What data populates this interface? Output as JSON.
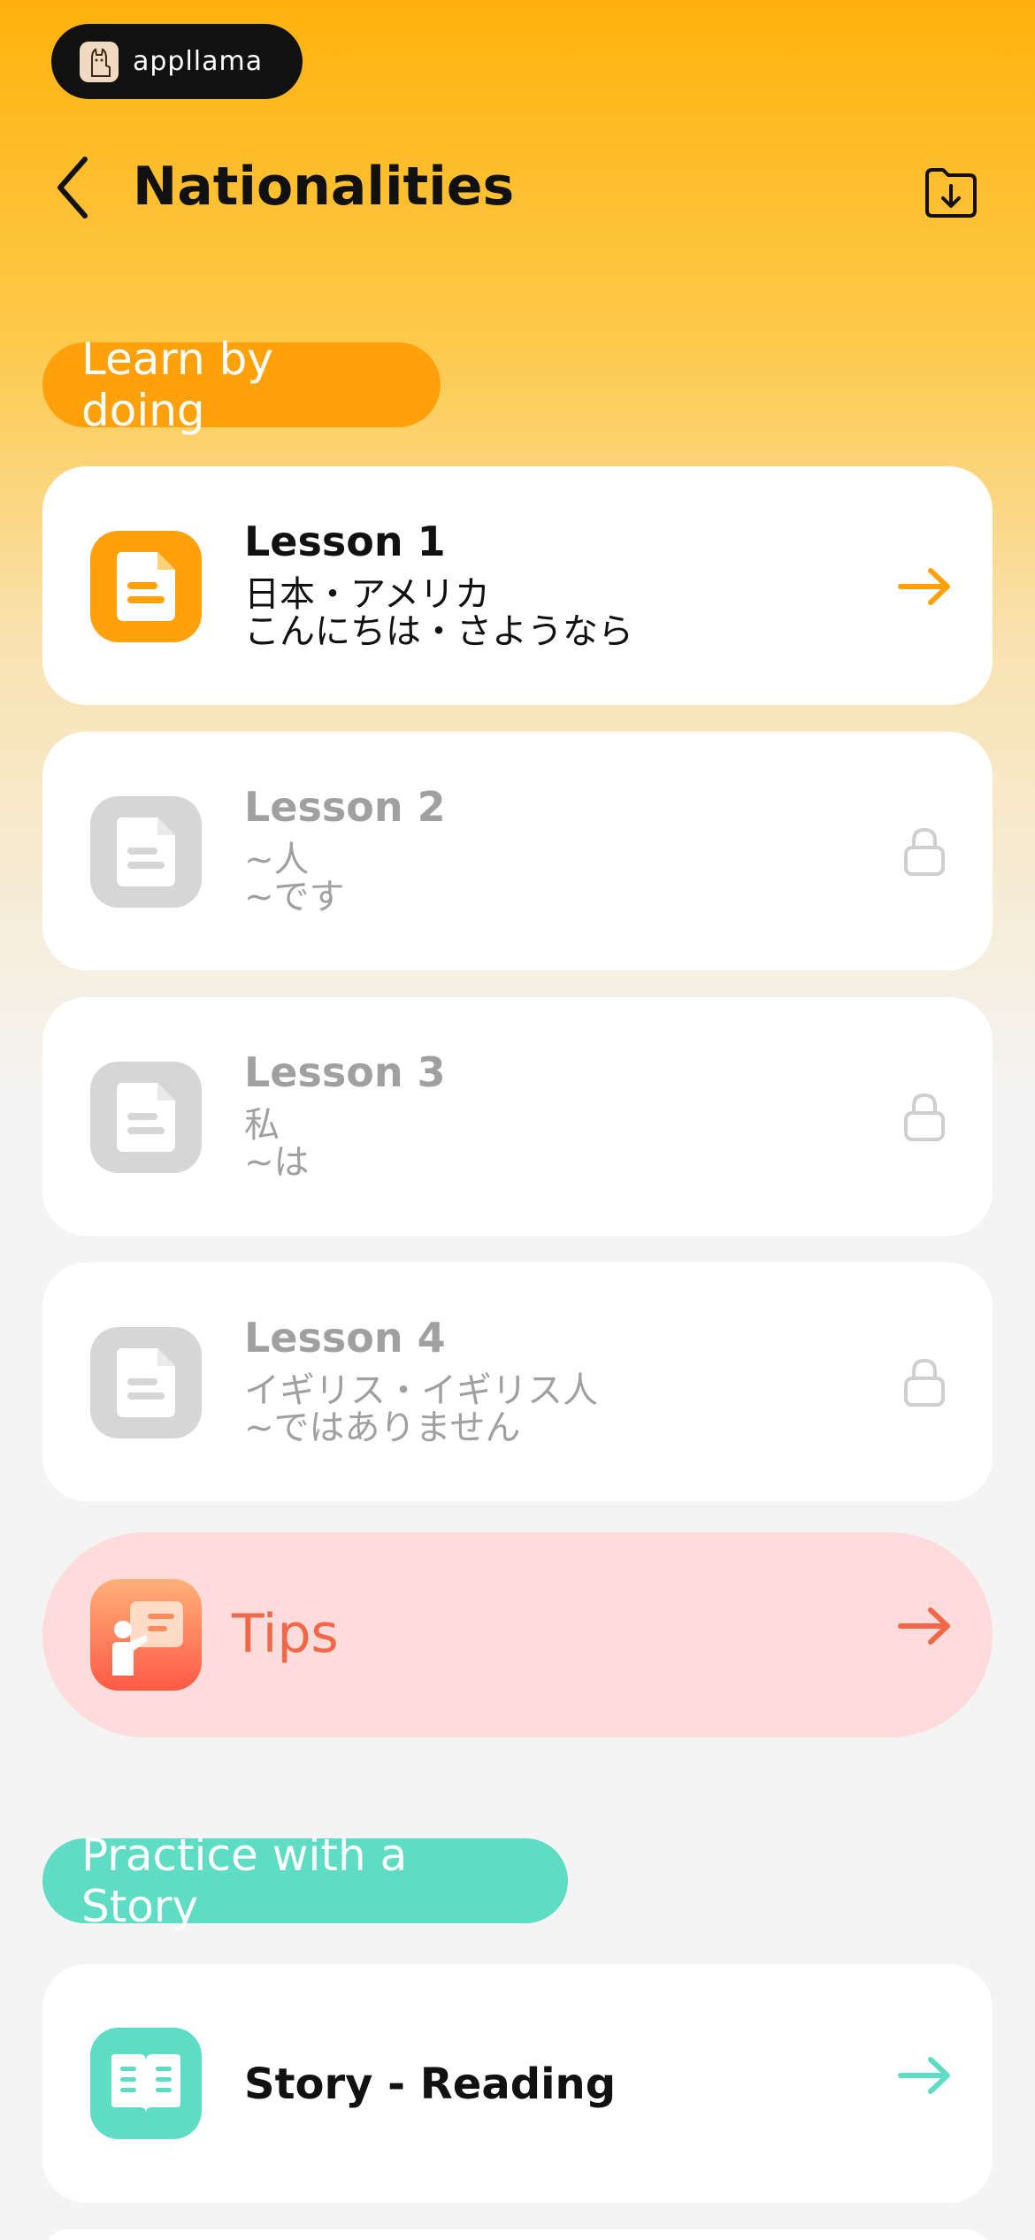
{
  "brand": {
    "name": "appllama"
  },
  "header": {
    "title": "Nationalities"
  },
  "sections": {
    "learn_label": "Learn by doing",
    "story_label": "Practice with a Story"
  },
  "lessons": [
    {
      "title": "Lesson 1",
      "line1": "日本・アメリカ",
      "line2": "こんにちは・さようなら",
      "locked": false
    },
    {
      "title": "Lesson 2",
      "line1": "~人",
      "line2": "~です",
      "locked": true
    },
    {
      "title": "Lesson 3",
      "line1": "私",
      "line2": "~は",
      "locked": true
    },
    {
      "title": "Lesson 4",
      "line1": "イギリス・イギリス人",
      "line2": "~ではありません",
      "locked": true
    }
  ],
  "tips": {
    "label": "Tips"
  },
  "story": {
    "label": "Story - Reading"
  },
  "icons": {
    "back": "chevron-left-icon",
    "save": "folder-download-icon",
    "lesson": "document-icon",
    "arrow": "arrow-right-icon",
    "lock": "lock-icon",
    "tips": "presentation-icon",
    "story": "open-book-icon"
  },
  "colors": {
    "accent_orange": "#ffa10a",
    "accent_teal": "#5edcc4",
    "tips_bg": "#fedcdc",
    "tips_text": "#f06848",
    "locked_gray": "#a0a0a0"
  }
}
